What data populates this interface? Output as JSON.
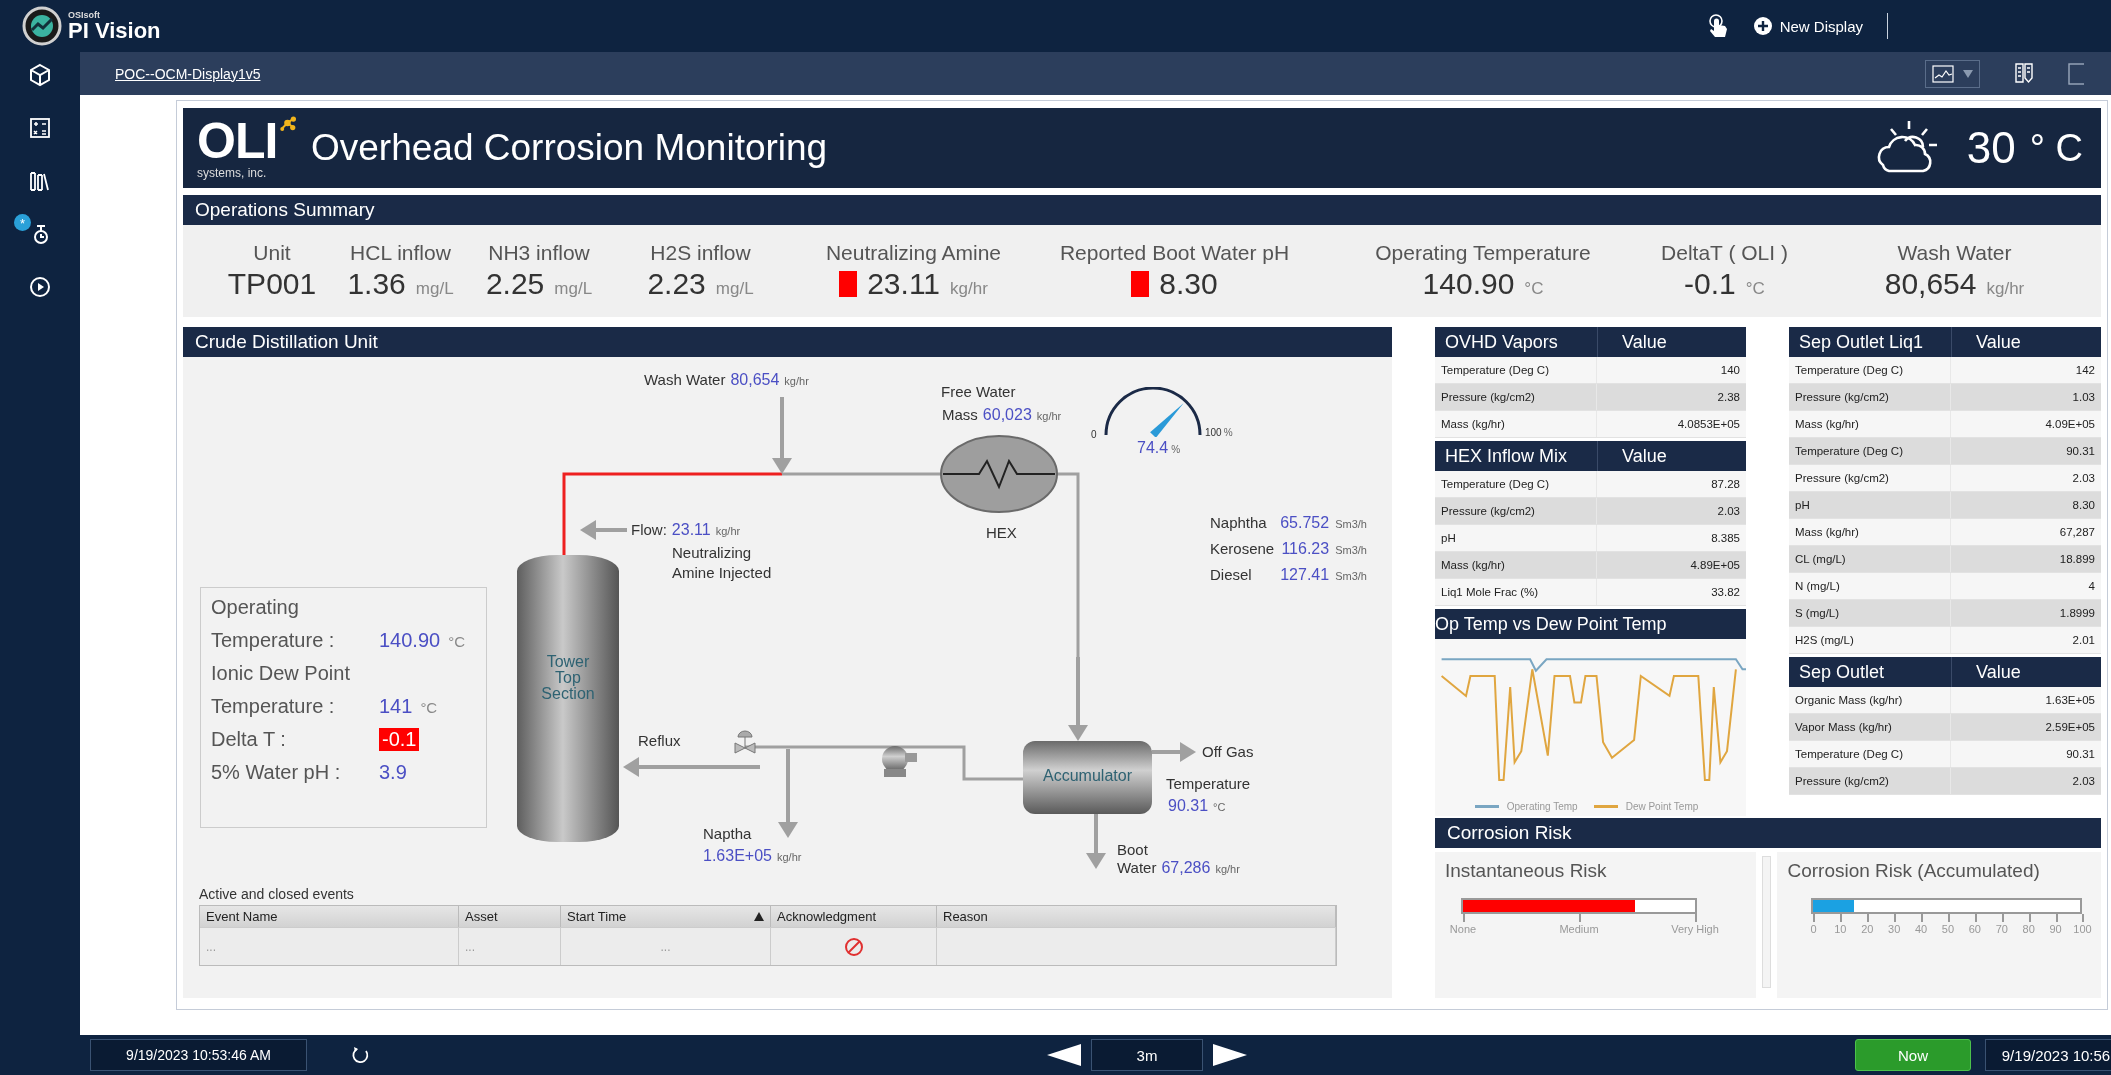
{
  "topbar": {
    "brand_small": "OSIsoft",
    "brand": "PI Vision",
    "new_display": "New Display"
  },
  "sidebar": {
    "badge": "*"
  },
  "breadcrumb": "POC--OCM-Display1v5",
  "header": {
    "logo": "OLI",
    "logo_sub": "systems, inc.",
    "title": "Overhead Corrosion Monitoring",
    "temperature": "30",
    "temperature_unit": "° C"
  },
  "summary": {
    "title": "Operations Summary",
    "items": [
      {
        "label": "Unit",
        "value": "TP001",
        "alarm": false
      },
      {
        "label": "HCL inflow",
        "value": "1.36",
        "unit": "mg/L",
        "alarm": false
      },
      {
        "label": "NH3 inflow",
        "value": "2.25",
        "unit": "mg/L",
        "alarm": false
      },
      {
        "label": "H2S inflow",
        "value": "2.23",
        "unit": "mg/L",
        "alarm": false
      },
      {
        "label": "Neutralizing Amine",
        "value": "23.11",
        "unit": "kg/hr",
        "alarm": true
      },
      {
        "label": "Reported Boot Water pH",
        "value": "8.30",
        "alarm": true
      },
      {
        "label": "Operating Temperature",
        "value": "140.90",
        "unit": "°C",
        "alarm": false
      },
      {
        "label": "DeltaT ( OLI )",
        "value": "-0.1",
        "unit": "°C",
        "alarm": false
      },
      {
        "label": "Wash Water",
        "value": "80,654",
        "unit": "kg/hr",
        "alarm": false
      }
    ]
  },
  "cdu": {
    "title": "Crude Distillation Unit",
    "annotations": [
      {
        "kind": "label",
        "text": "Wash Water",
        "value": "80,654",
        "unit": "kg/hr"
      },
      {
        "kind": "label",
        "text": "Free Water"
      },
      {
        "kind": "label",
        "text": "Mass",
        "value": "60,023",
        "unit": "kg/hr"
      },
      {
        "kind": "label",
        "text": "Flow:",
        "value": "23.11",
        "unit": "kg/hr"
      },
      {
        "kind": "label",
        "text": "Neutralizing Amine Injected"
      },
      {
        "kind": "label",
        "text": "HEX"
      },
      {
        "kind": "label",
        "text": "Reflux"
      },
      {
        "kind": "label",
        "text": "Naptha"
      },
      {
        "kind": "label",
        "value": "1.63E+05",
        "unit": "kg/hr"
      },
      {
        "kind": "label",
        "text": "Off Gas"
      },
      {
        "kind": "label",
        "text": "Temperature"
      },
      {
        "kind": "label",
        "value": "90.31",
        "unit": "°C"
      },
      {
        "kind": "label",
        "text": "Boot"
      },
      {
        "kind": "label",
        "text": "Water",
        "value": "67,286",
        "unit": "kg/hr"
      },
      {
        "kind": "vessel",
        "text": "Accumulator"
      },
      {
        "kind": "vessel",
        "text": "Tower Top Section"
      }
    ],
    "gauge": {
      "min": "0",
      "max": "100",
      "max_unit": "%",
      "value": "74.4",
      "unit": "%"
    },
    "products": [
      {
        "label": "Naphtha",
        "value": "65.752",
        "unit": "Sm3/h"
      },
      {
        "label": "Kerosene",
        "value": "116.23",
        "unit": "Sm3/h"
      },
      {
        "label": "Diesel",
        "value": "127.41",
        "unit": "Sm3/h"
      }
    ],
    "conditions": [
      {
        "label": "Operating"
      },
      {
        "label": "Temperature :",
        "value": "140.90",
        "unit": "°C",
        "alarm": false
      },
      {
        "label": "Ionic Dew Point"
      },
      {
        "label": "Temperature :",
        "value": "141",
        "unit": "°C",
        "alarm": false
      },
      {
        "label": "Delta T :",
        "value": "-0.1",
        "alarm": true
      },
      {
        "label": "5% Water pH :",
        "value": "3.9",
        "alarm": false
      }
    ],
    "events": {
      "title": "Active and closed events",
      "columns": [
        {
          "label": "Event Name",
          "sorted": false
        },
        {
          "label": "Asset",
          "sorted": false
        },
        {
          "label": "Start Time",
          "sorted": true
        },
        {
          "label": "Acknowledgment",
          "sorted": false
        },
        {
          "label": "Reason",
          "sorted": false
        }
      ],
      "rows": [
        {
          "event_name": "...",
          "asset": "...",
          "start_time": "...",
          "acknowledged": false
        }
      ]
    }
  },
  "column_a": {
    "tables": [
      {
        "title": "OVHD Vapors",
        "value_header": "Value",
        "rows": [
          {
            "name": "Temperature (Deg C)",
            "value": "140"
          },
          {
            "name": "Pressure (kg/cm2)",
            "value": "2.38"
          },
          {
            "name": "Mass (kg/hr)",
            "value": "4.0853E+05"
          }
        ]
      },
      {
        "title": "HEX Inflow Mix",
        "value_header": "Value",
        "rows": [
          {
            "name": "Temperature (Deg C)",
            "value": "87.28"
          },
          {
            "name": "Pressure (kg/cm2)",
            "value": "2.03"
          },
          {
            "name": "pH",
            "value": "8.385"
          },
          {
            "name": "Mass (kg/hr)",
            "value": "4.89E+05"
          },
          {
            "name": "Liq1 Mole Frac (%)",
            "value": "33.82"
          }
        ]
      }
    ],
    "chart": {
      "title": "Op Temp vs Dew Point Temp",
      "legend": [
        {
          "label": "Operating Temp",
          "color": "#7aa6c2"
        },
        {
          "label": "Dew Point Temp",
          "color": "#e0a640"
        }
      ]
    }
  },
  "column_b": {
    "tables": [
      {
        "title": "Sep Outlet Liq1",
        "value_header": "Value",
        "rows": [
          {
            "name": "Temperature (Deg C)",
            "value": "142"
          },
          {
            "name": "Pressure (kg/cm2)",
            "value": "1.03"
          },
          {
            "name": "Mass (kg/hr)",
            "value": "4.09E+05"
          },
          {
            "name": "Temperature (Deg C)",
            "value": "90.31"
          },
          {
            "name": "Pressure (kg/cm2)",
            "value": "2.03"
          },
          {
            "name": "pH",
            "value": "8.30"
          },
          {
            "name": "Mass (kg/hr)",
            "value": "67,287"
          },
          {
            "name": "CL (mg/L)",
            "value": "18.899"
          },
          {
            "name": "N (mg/L)",
            "value": "4"
          },
          {
            "name": "S (mg/L)",
            "value": "1.8999"
          },
          {
            "name": "H2S (mg/L)",
            "value": "2.01"
          }
        ]
      },
      {
        "title": "Sep Outlet",
        "value_header": "Value",
        "rows": [
          {
            "name": "Organic Mass (kg/hr)",
            "value": "1.63E+05"
          },
          {
            "name": "Vapor Mass (kg/hr)",
            "value": "2.59E+05"
          },
          {
            "name": "Temperature (Deg C)",
            "value": "90.31"
          },
          {
            "name": "Pressure (kg/cm2)",
            "value": "2.03"
          }
        ]
      }
    ]
  },
  "corrosion": {
    "title": "Corrosion Risk",
    "panels": [
      {
        "title": "Instantaneous Risk",
        "level": 0.74,
        "color": "#ff0000",
        "ticks": [
          "None",
          "Medium",
          "Very High"
        ]
      },
      {
        "title": "Corrosion Risk (Accumulated)",
        "level": 0.15,
        "color": "#1ba1e2",
        "ticks": [
          "0",
          "10",
          "20",
          "30",
          "40",
          "50",
          "60",
          "70",
          "80",
          "90",
          "100"
        ]
      }
    ]
  },
  "timebar": {
    "start_time": "9/19/2023 10:53:46 AM",
    "duration": "3m",
    "now": "Now",
    "end_time": "9/19/2023 10:56"
  }
}
